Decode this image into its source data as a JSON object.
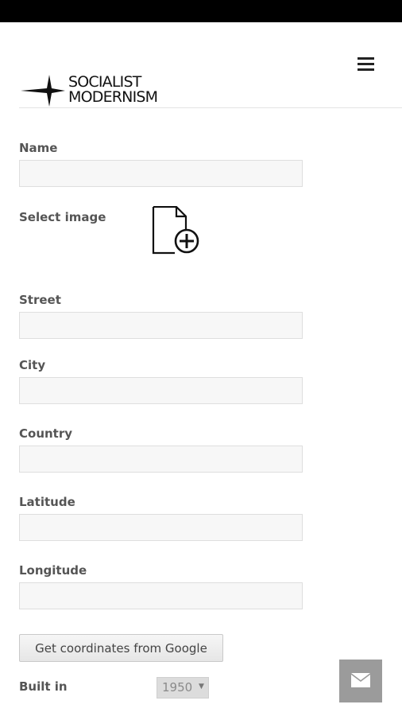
{
  "app": {
    "logo_line1": "SOCIALIST",
    "logo_line2": "MODERNISM"
  },
  "header": {
    "menu_icon": "hamburger-menu-icon"
  },
  "form": {
    "name_label": "Name",
    "name_value": "",
    "image_label": "Select image",
    "image_icon": "add-file-icon",
    "street_label": "Street",
    "street_value": "",
    "city_label": "City",
    "city_value": "",
    "country_label": "Country",
    "country_value": "",
    "latitude_label": "Latitude",
    "latitude_value": "",
    "longitude_label": "Longitude",
    "longitude_value": "",
    "google_button_label": "Get coordinates from Google",
    "built_in_label": "Built in",
    "built_in_selected": "1950"
  },
  "fab": {
    "icon": "mail-icon",
    "color": "#9b9b9b"
  }
}
